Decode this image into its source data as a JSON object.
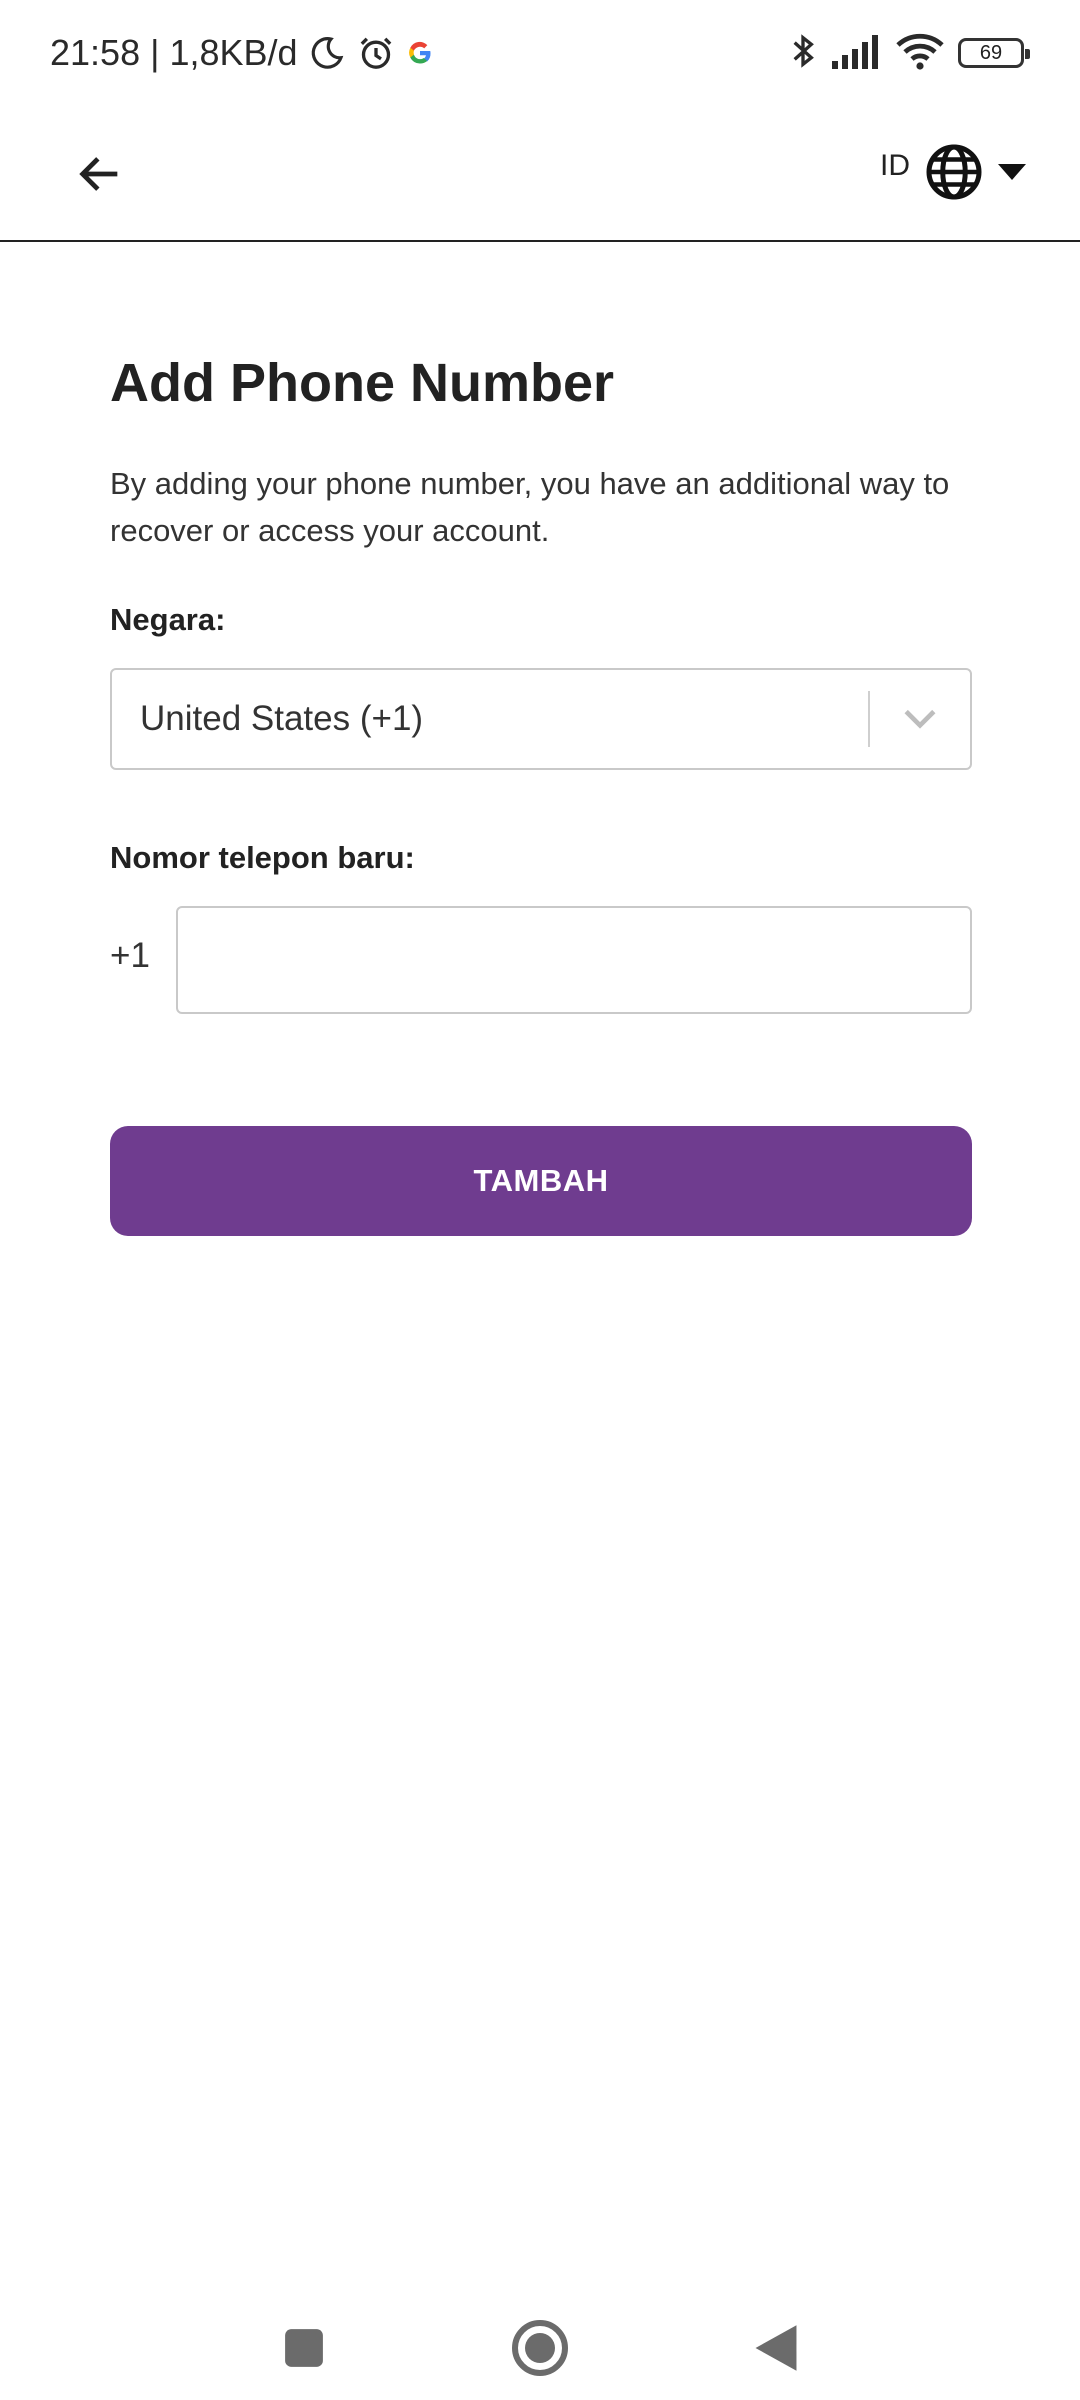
{
  "status_bar": {
    "time_speed": "21:58 | 1,8KB/d",
    "battery": "69",
    "icons": [
      "moon-icon",
      "alarm-icon",
      "google-icon",
      "bluetooth-icon",
      "signal-icon",
      "wifi-icon",
      "battery-icon"
    ]
  },
  "app_bar": {
    "back_icon": "arrow-left-icon",
    "language_code": "ID",
    "globe_icon": "globe-icon",
    "dropdown_icon": "caret-down-icon"
  },
  "form": {
    "title": "Add Phone Number",
    "description": "By adding your phone number, you have an additional way to recover or access your account.",
    "country_label": "Negara:",
    "country_value": "United States (+1)",
    "phone_label": "Nomor telepon baru:",
    "phone_prefix": "+1",
    "phone_value": "",
    "submit_label": "TAMBAH"
  },
  "colors": {
    "accent": "#6f3c8f",
    "text": "#222222",
    "border": "#c9c9c9"
  },
  "nav_bar": {
    "icons": [
      "recents-square-icon",
      "home-circle-icon",
      "back-triangle-icon"
    ]
  }
}
